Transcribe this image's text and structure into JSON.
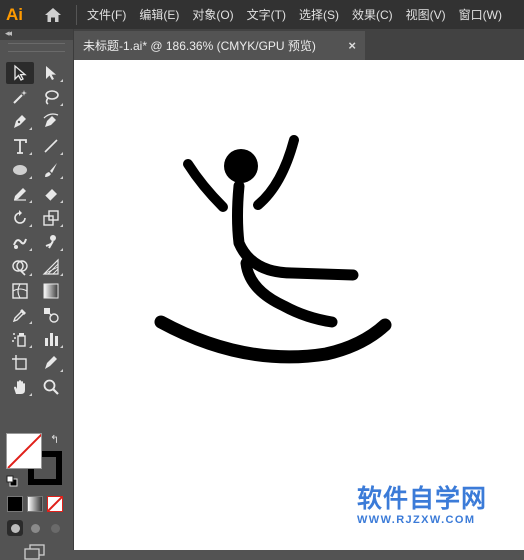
{
  "app": {
    "logo_text": "Ai",
    "home_icon": "home-icon"
  },
  "menu": [
    "文件(F)",
    "编辑(E)",
    "对象(O)",
    "文字(T)",
    "选择(S)",
    "效果(C)",
    "视图(V)",
    "窗口(W)"
  ],
  "document_tab": {
    "title": "未标题-1.ai* @ 186.36% (CMYK/GPU 预览)",
    "close_symbol": "×"
  },
  "toolbar": {
    "collapse_symbol": "◂◂",
    "tools": [
      [
        "selection-tool-icon",
        "direct-selection-tool-icon"
      ],
      [
        "magic-wand-tool-icon",
        "lasso-tool-icon"
      ],
      [
        "pen-tool-icon",
        "curvature-tool-icon"
      ],
      [
        "type-tool-icon",
        "line-segment-tool-icon"
      ],
      [
        "ellipse-tool-icon",
        "paintbrush-tool-icon"
      ],
      [
        "pencil-tool-icon",
        "eraser-tool-icon"
      ],
      [
        "rotate-tool-icon",
        "scale-tool-icon"
      ],
      [
        "warp-tool-icon",
        "puppet-warp-tool-icon"
      ],
      [
        "shape-builder-tool-icon",
        "perspective-grid-tool-icon"
      ],
      [
        "mesh-tool-icon",
        "gradient-tool-icon"
      ],
      [
        "eyedropper-tool-icon",
        "blend-tool-icon"
      ],
      [
        "symbol-sprayer-tool-icon",
        "column-graph-tool-icon"
      ],
      [
        "artboard-tool-icon",
        "slice-tool-icon"
      ],
      [
        "hand-tool-icon",
        "zoom-tool-icon"
      ]
    ],
    "active_tool": "selection-tool-icon",
    "fill_color": "none",
    "stroke_color": "#000000",
    "swap_symbol": "↰"
  },
  "watermark": {
    "title": "软件自学网",
    "url": "WWW.RJZXW.COM",
    "color": "#3b7bd8"
  }
}
